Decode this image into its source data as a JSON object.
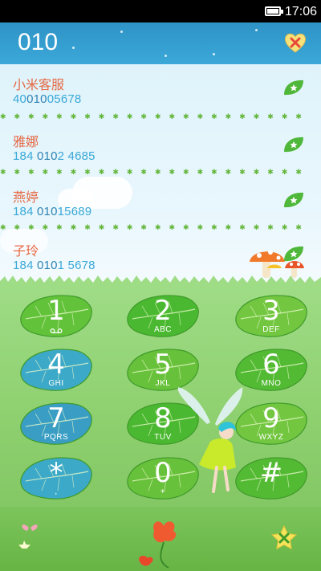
{
  "status_bar": {
    "time": "17:06",
    "battery_icon": "battery-icon"
  },
  "dialer": {
    "dialed_number": "010",
    "delete_icon": "heart-delete-icon"
  },
  "contacts": [
    {
      "name": "小米客服",
      "number_parts": [
        "40",
        "010",
        "05678"
      ],
      "highlight_index": 1,
      "action_icon": "leaf-icon"
    },
    {
      "name": "雅娜",
      "number_parts": [
        "184 ",
        "010",
        "2 4685"
      ],
      "highlight_index": 1,
      "action_icon": "leaf-icon"
    },
    {
      "name": "燕婷",
      "number_parts": [
        "184 ",
        "010",
        "15689"
      ],
      "highlight_index": 1,
      "action_icon": "leaf-icon"
    },
    {
      "name": "子玲",
      "number_parts": [
        "184 ",
        "010",
        "1 5678"
      ],
      "highlight_index": 1,
      "action_icon": "leaf-icon"
    }
  ],
  "keypad": [
    {
      "digit": "1",
      "sub": ""
    },
    {
      "digit": "2",
      "sub": "ABC"
    },
    {
      "digit": "3",
      "sub": "DEF"
    },
    {
      "digit": "4",
      "sub": "GHI"
    },
    {
      "digit": "5",
      "sub": "JKL"
    },
    {
      "digit": "6",
      "sub": "MNO"
    },
    {
      "digit": "7",
      "sub": "PQRS"
    },
    {
      "digit": "8",
      "sub": "TUV"
    },
    {
      "digit": "9",
      "sub": "WXYZ"
    },
    {
      "digit": "*",
      "sub": ","
    },
    {
      "digit": "0",
      "sub": "+"
    },
    {
      "digit": "#",
      "sub": ""
    }
  ],
  "colors": {
    "header_blue": "#3aa8d8",
    "name_orange": "#e56a45",
    "number_blue": "#3aa8d8",
    "leaf_green": "#5cbf3a",
    "background_green": "#8ed06f"
  }
}
